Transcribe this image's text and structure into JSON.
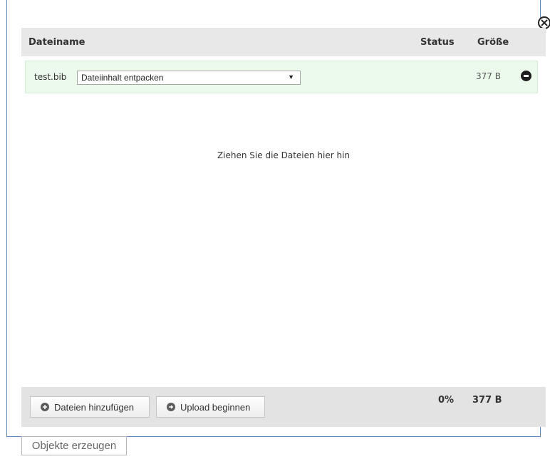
{
  "header": {
    "filename_label": "Dateiname",
    "status_label": "Status",
    "size_label": "Größe"
  },
  "files": [
    {
      "name": "test.bib",
      "action_selected": "Dateiinhalt entpacken",
      "size": "377 B"
    }
  ],
  "drop_hint": "Ziehen Sie die Dateien hier hin",
  "footer": {
    "add_files_label": "Dateien hinzufügen",
    "start_upload_label": "Upload beginnen",
    "total_percent": "0%",
    "total_size": "377 B"
  },
  "create_objects_label": "Objekte erzeugen",
  "icons": {
    "close": "close-icon",
    "remove": "minus-circle-icon",
    "add": "plus-circle-icon",
    "upload": "arrow-circle-icon"
  },
  "colors": {
    "row_bg": "#ebfaeb",
    "header_bg": "#e8e8e8",
    "frame_border": "#5f86b7"
  }
}
